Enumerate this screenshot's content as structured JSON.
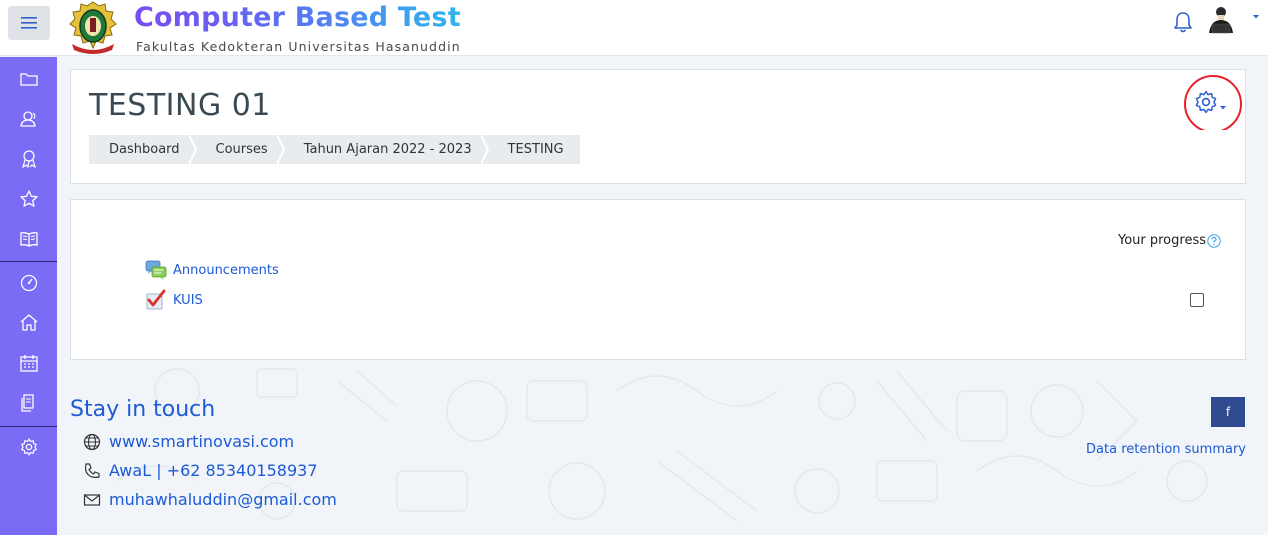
{
  "app": {
    "title": "Computer Based Test",
    "subtitle": "Fakultas Kedokteran Universitas Hasanuddin"
  },
  "navbar": {
    "menu_icon": "hamburger-menu-icon",
    "notification_icon": "bell-icon",
    "user_icon": "user-avatar",
    "user_menu_icon": "caret-down-icon"
  },
  "sidebar": {
    "items": [
      {
        "icon": "folder-icon"
      },
      {
        "icon": "users-icon"
      },
      {
        "icon": "badge-icon"
      },
      {
        "icon": "star-icon"
      },
      {
        "icon": "book-icon"
      },
      {
        "icon": "dashboard-gauge-icon"
      },
      {
        "icon": "home-icon"
      },
      {
        "icon": "calendar-icon"
      },
      {
        "icon": "files-icon"
      },
      {
        "icon": "settings-gear-icon"
      }
    ]
  },
  "page": {
    "title": "TESTING 01",
    "settings_icon": "gear-icon",
    "breadcrumb": [
      "Dashboard",
      "Courses",
      "Tahun Ajaran 2022 - 2023",
      "TESTING"
    ]
  },
  "course": {
    "progress_label": "Your progress",
    "help_icon": "question-circle-icon",
    "activities": [
      {
        "label": "Announcements",
        "icon": "forum-icon"
      },
      {
        "label": "KUIS",
        "icon": "quiz-checkmark-icon",
        "completion": false
      }
    ]
  },
  "footer": {
    "heading": "Stay in touch",
    "contacts": [
      {
        "icon": "globe-icon",
        "text": "www.smartinovasi.com"
      },
      {
        "icon": "phone-icon",
        "text": "AwaL | +62 85340158937"
      },
      {
        "icon": "envelope-icon",
        "text": "muhawhaluddin@gmail.com"
      }
    ],
    "facebook_label": "f",
    "data_retention": "Data retention summary"
  },
  "colors": {
    "sidebar": "#7b6cf6",
    "link": "#1c5ad6",
    "highlight_ring": "#e8202a"
  }
}
